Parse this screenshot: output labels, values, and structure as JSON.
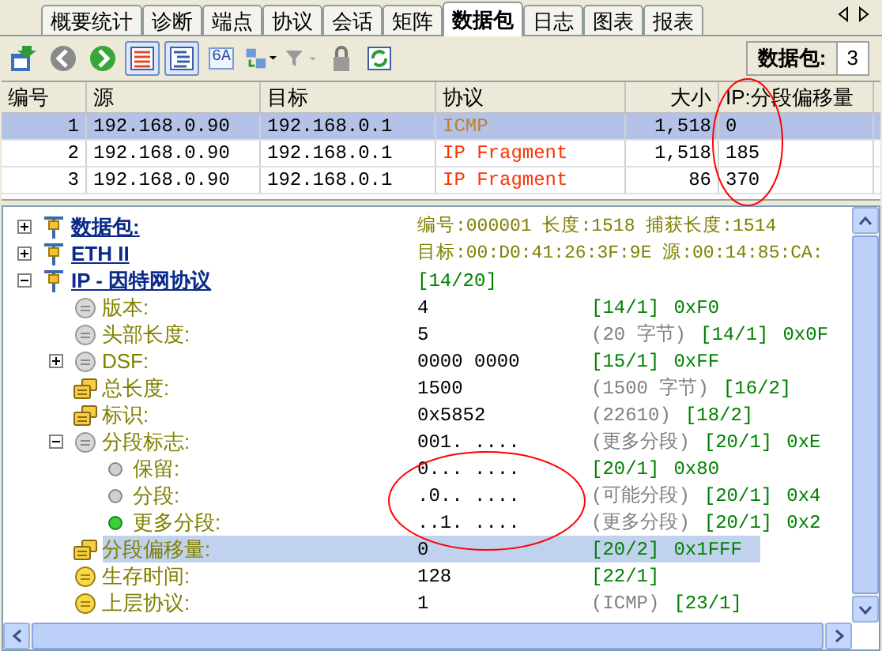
{
  "tabs": [
    {
      "label": "概要统计",
      "selected": false
    },
    {
      "label": "诊断",
      "selected": false
    },
    {
      "label": "端点",
      "selected": false
    },
    {
      "label": "协议",
      "selected": false
    },
    {
      "label": "会话",
      "selected": false
    },
    {
      "label": "矩阵",
      "selected": false
    },
    {
      "label": "数据包",
      "selected": true
    },
    {
      "label": "日志",
      "selected": false
    },
    {
      "label": "图表",
      "selected": false
    },
    {
      "label": "报表",
      "selected": false
    }
  ],
  "toolbar": [
    {
      "kind": "export",
      "pressed": false
    },
    {
      "kind": "back",
      "pressed": false
    },
    {
      "kind": "forward",
      "pressed": false
    },
    {
      "kind": "list",
      "pressed": true
    },
    {
      "kind": "tree",
      "pressed": true
    },
    {
      "kind": "hex",
      "label": "6A",
      "pressed": false
    },
    {
      "kind": "layout",
      "pressed": false
    },
    {
      "kind": "filter",
      "pressed": false
    },
    {
      "kind": "lock",
      "pressed": false
    },
    {
      "kind": "refresh",
      "pressed": false
    }
  ],
  "packet_counter": {
    "label": "数据包:",
    "value": "3"
  },
  "table": {
    "columns": [
      "编号",
      "源",
      "目标",
      "协议",
      "大小",
      "IP:分段偏移量"
    ],
    "rows": [
      {
        "cells": [
          "1",
          "192.168.0.90",
          "192.168.0.1",
          "ICMP",
          "1,518",
          "0"
        ],
        "color": "#c08030",
        "selected": true
      },
      {
        "cells": [
          "2",
          "192.168.0.90",
          "192.168.0.1",
          "IP Fragment",
          "1,518",
          "185"
        ],
        "color": "#ff3300",
        "selected": false
      },
      {
        "cells": [
          "3",
          "192.168.0.90",
          "192.168.0.1",
          "IP Fragment",
          "86",
          "370"
        ],
        "color": "#ff3300",
        "selected": false
      }
    ]
  },
  "tree": [
    {
      "kind": "header",
      "label": "数据包:",
      "expanded": false,
      "selected": false,
      "summary": "编号:000001 长度:1518 捕获长度:1514"
    },
    {
      "kind": "header",
      "label": "ETH II",
      "expanded": false,
      "selected": false,
      "summary": "目标:00:D0:41:26:3F:9E 源:00:14:85:CA:"
    },
    {
      "kind": "header",
      "label": "IP - 因特网协议",
      "expanded": true,
      "selected": false,
      "bytes": "[14/20]",
      "children": [
        {
          "kind": "field",
          "label": "版本:",
          "selected": false,
          "value": "4",
          "bytes": "[14/1]",
          "hex": "0xF0"
        },
        {
          "kind": "field",
          "label": "头部长度:",
          "selected": false,
          "value": "5",
          "desc": "(20 字节)",
          "bytes": "[14/1]",
          "hex": "0x0F"
        },
        {
          "kind": "field",
          "label": "DSF:",
          "expanded": false,
          "selected": false,
          "value": "0000 0000",
          "bytes": "[15/1]",
          "hex": "0xFF"
        },
        {
          "kind": "group",
          "label": "总长度:",
          "selected": false,
          "value": "1500",
          "desc": "(1500 字节)",
          "bytes": "[16/2]"
        },
        {
          "kind": "group",
          "label": "标识:",
          "selected": false,
          "value": "0x5852",
          "desc": "(22610)",
          "bytes": "[18/2]"
        },
        {
          "kind": "field",
          "label": "分段标志:",
          "expanded": true,
          "selected": false,
          "value": "001. ....",
          "desc": "(更多分段)",
          "bytes": "[20/1]",
          "hex": "0xE",
          "children": [
            {
              "kind": "bit_off",
              "label": "保留:",
              "selected": false,
              "value": "0... ....",
              "bytes": "[20/1]",
              "hex": "0x80"
            },
            {
              "kind": "bit_off",
              "label": "分段:",
              "selected": false,
              "value": ".0.. ....",
              "desc": "(可能分段)",
              "bytes": "[20/1]",
              "hex": "0x4"
            },
            {
              "kind": "bit_on",
              "label": "更多分段:",
              "selected": false,
              "value": "..1. ....",
              "desc": "(更多分段)",
              "bytes": "[20/1]",
              "hex": "0x2"
            }
          ]
        },
        {
          "kind": "group",
          "label": "分段偏移量:",
          "selected": true,
          "value": "0",
          "bytes": "[20/2]",
          "hex": "0x1FFF"
        },
        {
          "kind": "value",
          "label": "生存时间:",
          "selected": false,
          "value": "128",
          "bytes": "[22/1]"
        },
        {
          "kind": "value",
          "label": "上层协议:",
          "selected": false,
          "value": "1",
          "desc": "(ICMP)",
          "bytes": "[23/1]"
        }
      ]
    }
  ]
}
